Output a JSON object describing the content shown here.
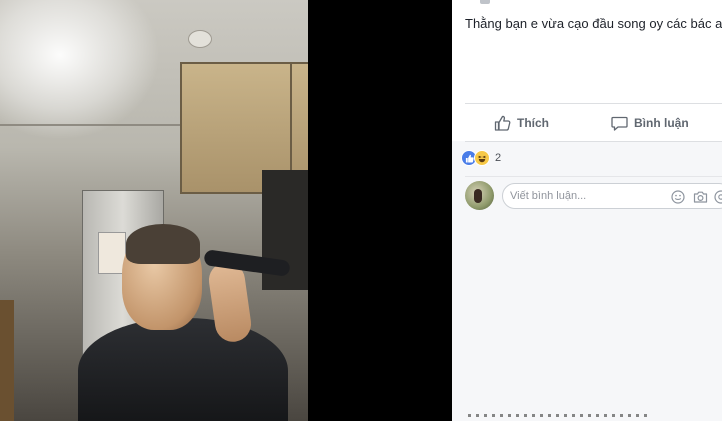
{
  "post": {
    "caption": "Thằng bạn e vừa cạo đầu song oy các bác ak"
  },
  "actions": {
    "like_label": "Thích",
    "comment_label": "Bình luận"
  },
  "reactions": {
    "types": [
      "like",
      "haha"
    ],
    "count": "2"
  },
  "comment_composer": {
    "placeholder": "Viết bình luận..."
  },
  "icons": {
    "like": "thumbs-up-icon",
    "comment": "speech-bubble-icon",
    "emoji": "smiley-icon",
    "camera": "camera-icon",
    "gif": "gif-icon"
  },
  "colors": {
    "link_blue": "#4a7de8",
    "haha_yellow": "#f7c947",
    "text_primary": "#1d2129",
    "text_secondary": "#606770"
  }
}
